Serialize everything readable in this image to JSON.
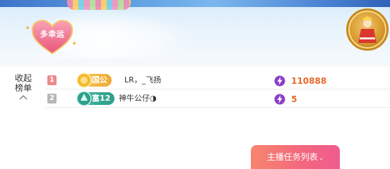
{
  "banner": {
    "lucky_badge_label": "多幸运",
    "accent_pink": "#ef6f8e",
    "accent_gold": "#d69a2e"
  },
  "sidebar": {
    "collapse_label": "收起榜单"
  },
  "ranking": [
    {
      "rank": "1",
      "badge": "国公",
      "badge_style": "gold",
      "name": "LR，_飞扬",
      "score": "110888"
    },
    {
      "rank": "2",
      "badge": "富12",
      "badge_style": "teal",
      "name": "神牛公仔◑",
      "score": "5"
    }
  ],
  "footer": {
    "task_button_label": "主播任务列表",
    "task_button_caret": "⌄"
  }
}
